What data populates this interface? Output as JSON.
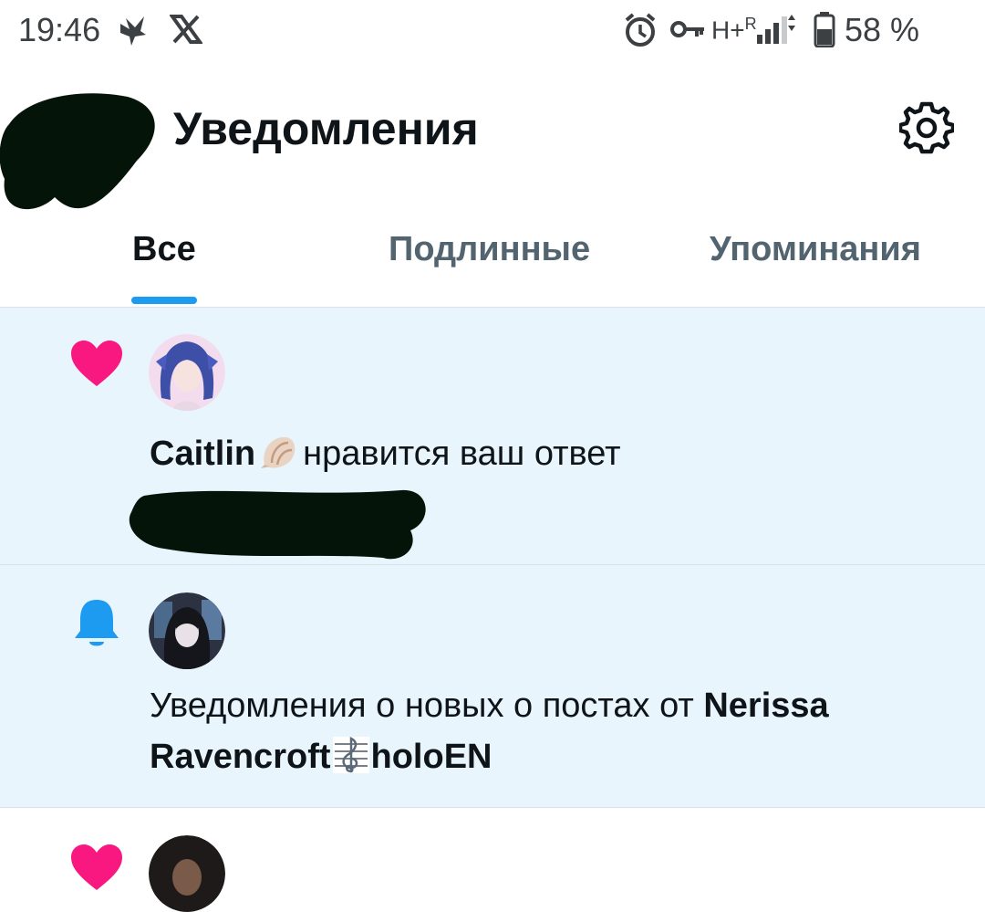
{
  "status_bar": {
    "time": "19:46",
    "network": "H+",
    "roaming": "R",
    "battery": "58 %"
  },
  "header": {
    "title": "Уведомления",
    "settings_icon": "gear-icon"
  },
  "tabs": [
    {
      "label": "Все",
      "active": true
    },
    {
      "label": "Подлинные",
      "active": false
    },
    {
      "label": "Упоминания",
      "active": false
    }
  ],
  "notifications": [
    {
      "type": "like",
      "icon": "heart-icon",
      "user": "Caitlin",
      "action": "нравится ваш ответ"
    },
    {
      "type": "subscription",
      "icon": "bell-icon",
      "text_prefix": "Уведомления о новых о постах от",
      "user_part1": "Nerissa",
      "user_part2": "Ravencroft",
      "user_part3": "holoEN"
    },
    {
      "type": "like",
      "icon": "heart-icon"
    }
  ],
  "colors": {
    "accent": "#1d9bf0",
    "like": "#f91880",
    "highlight_bg": "#e8f5fd"
  }
}
